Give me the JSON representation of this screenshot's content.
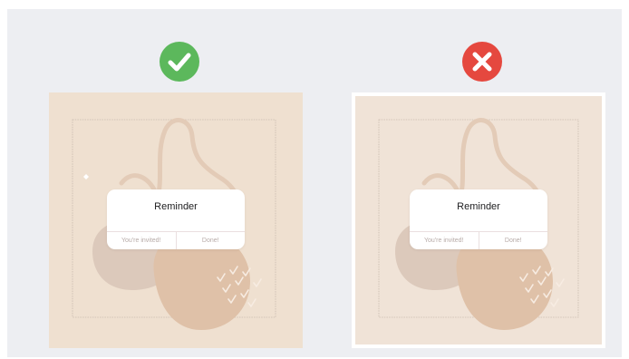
{
  "colors": {
    "correct": "#5cb85c",
    "incorrect": "#e5483f",
    "panel_background": "#efe0d0",
    "outline_border": "#ffffff",
    "page_background": "#edeef2"
  },
  "examples": [
    {
      "verdict_icon": "check-icon",
      "dialog": {
        "title": "Reminder",
        "buttons": [
          "You're invited!",
          "Done!"
        ]
      }
    },
    {
      "verdict_icon": "close-icon",
      "dialog": {
        "title": "Reminder",
        "buttons": [
          "You're invited!",
          "Done!"
        ]
      }
    }
  ]
}
